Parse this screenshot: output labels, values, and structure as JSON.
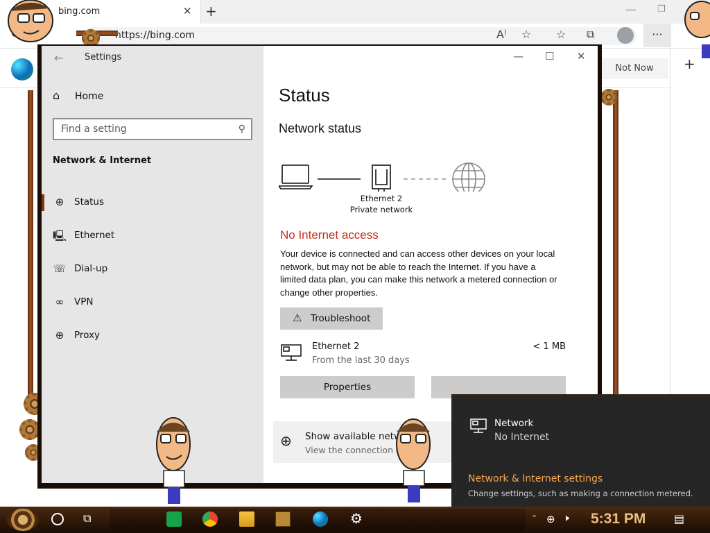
{
  "browser": {
    "tab_title": "bing.com",
    "tab_close": "✕",
    "new_tab": "+",
    "url": "https://bing.com",
    "not_now_label": "Not Now",
    "more_label": "···",
    "sidebar_add": "+"
  },
  "settings": {
    "window_title": "Settings",
    "home_label": "Home",
    "search_placeholder": "Find a setting",
    "section_header": "Network & Internet",
    "nav_items": [
      {
        "label": "Status",
        "icon": "globe-icon",
        "glyph": "⊕"
      },
      {
        "label": "Ethernet",
        "icon": "ethernet-icon",
        "glyph": "🖳"
      },
      {
        "label": "Dial-up",
        "icon": "dialup-icon",
        "glyph": "☏"
      },
      {
        "label": "VPN",
        "icon": "vpn-icon",
        "glyph": "∞"
      },
      {
        "label": "Proxy",
        "icon": "proxy-icon",
        "glyph": "⊕"
      }
    ],
    "selected_nav": "Status"
  },
  "status": {
    "title": "Status",
    "heading": "Network status",
    "adapter_name": "Ethernet 2",
    "network_type": "Private network",
    "alert": "No Internet access",
    "description": "Your device is connected and can access other devices on your local network, but may not be able to reach the Internet. If you have a limited data plan, you can make this network a metered connection or change other properties.",
    "troubleshoot_label": "Troubleshoot",
    "connection": {
      "name": "Ethernet 2",
      "period": "From the last 30 days",
      "usage": "< 1 MB"
    },
    "properties_label": "Properties",
    "show_networks_title": "Show available netwo",
    "show_networks_sub": "View the connection op"
  },
  "flyout": {
    "network_name": "Network",
    "network_status": "No Internet",
    "settings_link": "Network & Internet settings",
    "settings_sub": "Change settings, such as making a connection metered."
  },
  "taskbar": {
    "clock": "5:31 PM"
  },
  "colors": {
    "alert_red": "#c42b1c",
    "link_orange": "#f7a54a",
    "taskbar_brown": "#2d1708"
  }
}
